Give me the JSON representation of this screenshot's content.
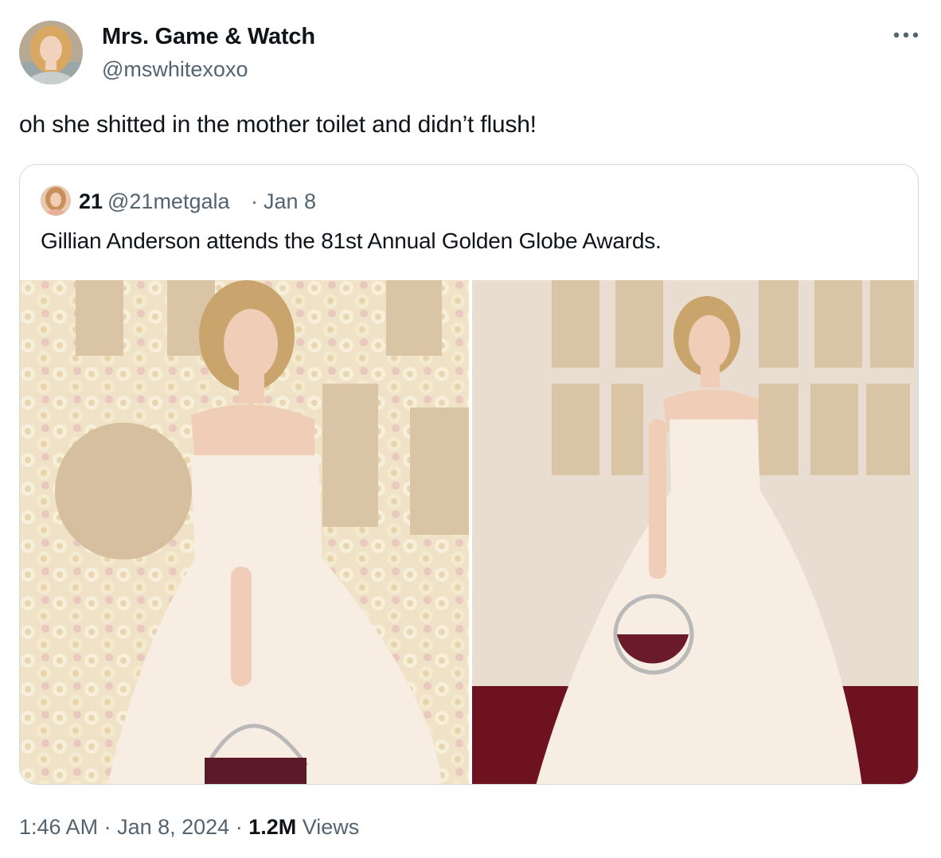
{
  "author": {
    "name": "Mrs. Game & Watch",
    "handle": "@mswhitexoxo",
    "avatar_icon": "user-avatar-photo"
  },
  "tweet": {
    "text": "oh she shitted in the mother toilet and didn’t flush!",
    "more_icon": "more-options-icon"
  },
  "quoted": {
    "name": "21",
    "handle": "@21metgala",
    "separator": "·",
    "date": "Jan 8",
    "text": "Gillian Anderson attends the 81st Annual Golden Globe Awards.",
    "photos": [
      "photo-left",
      "photo-right"
    ]
  },
  "footer": {
    "time": "1:46 AM",
    "sep1": " · ",
    "date": "Jan 8, 2024",
    "sep2": " · ",
    "views_count": "1.2M",
    "views_label": " Views"
  },
  "colors": {
    "text": "#0f1419",
    "secondary": "#536471",
    "border": "#cfd9de",
    "backdrop_flowers": "#f1e6cc",
    "backdrop_wall": "#e9ddd1",
    "letters": "#d9c4a6",
    "carpet": "#6e1220",
    "dress": "#f7ede2"
  }
}
